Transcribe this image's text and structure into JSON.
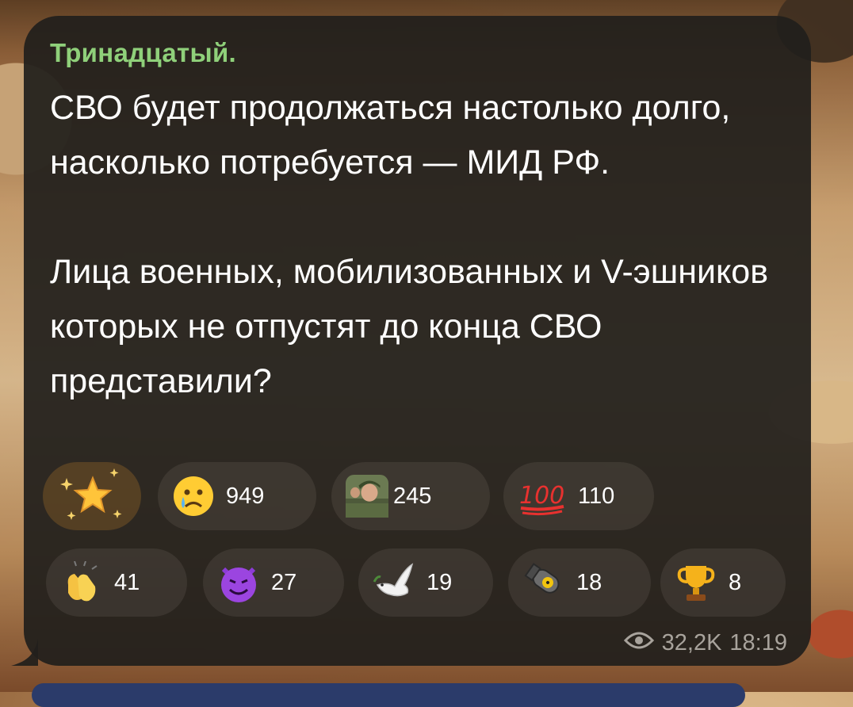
{
  "message": {
    "sender": "Тринадцатый.",
    "text": "СВО будет продолжаться настолько долго, насколько потребуется — МИД РФ.\n\nЛица военных, мобилизованных и V-эшников которых не отпустят до конца СВО представили?",
    "views": "32,2K",
    "time": "18:19"
  },
  "reactions": [
    {
      "icon": "star-icon",
      "count": ""
    },
    {
      "icon": "crying-face-icon",
      "count": "949"
    },
    {
      "icon": "custom-photo-reaction-icon",
      "count": "245"
    },
    {
      "icon": "hundred-points-icon",
      "count": "110"
    },
    {
      "icon": "clapping-hands-icon",
      "count": "41"
    },
    {
      "icon": "smiling-devil-icon",
      "count": "27"
    },
    {
      "icon": "dove-icon",
      "count": "19"
    },
    {
      "icon": "bomb-icon",
      "count": "18"
    },
    {
      "icon": "trophy-icon",
      "count": "8"
    }
  ],
  "colors": {
    "sender": "#8fd07a",
    "bubble": "#211f1c",
    "text": "#ffffff",
    "meta": "#a8a39c"
  }
}
